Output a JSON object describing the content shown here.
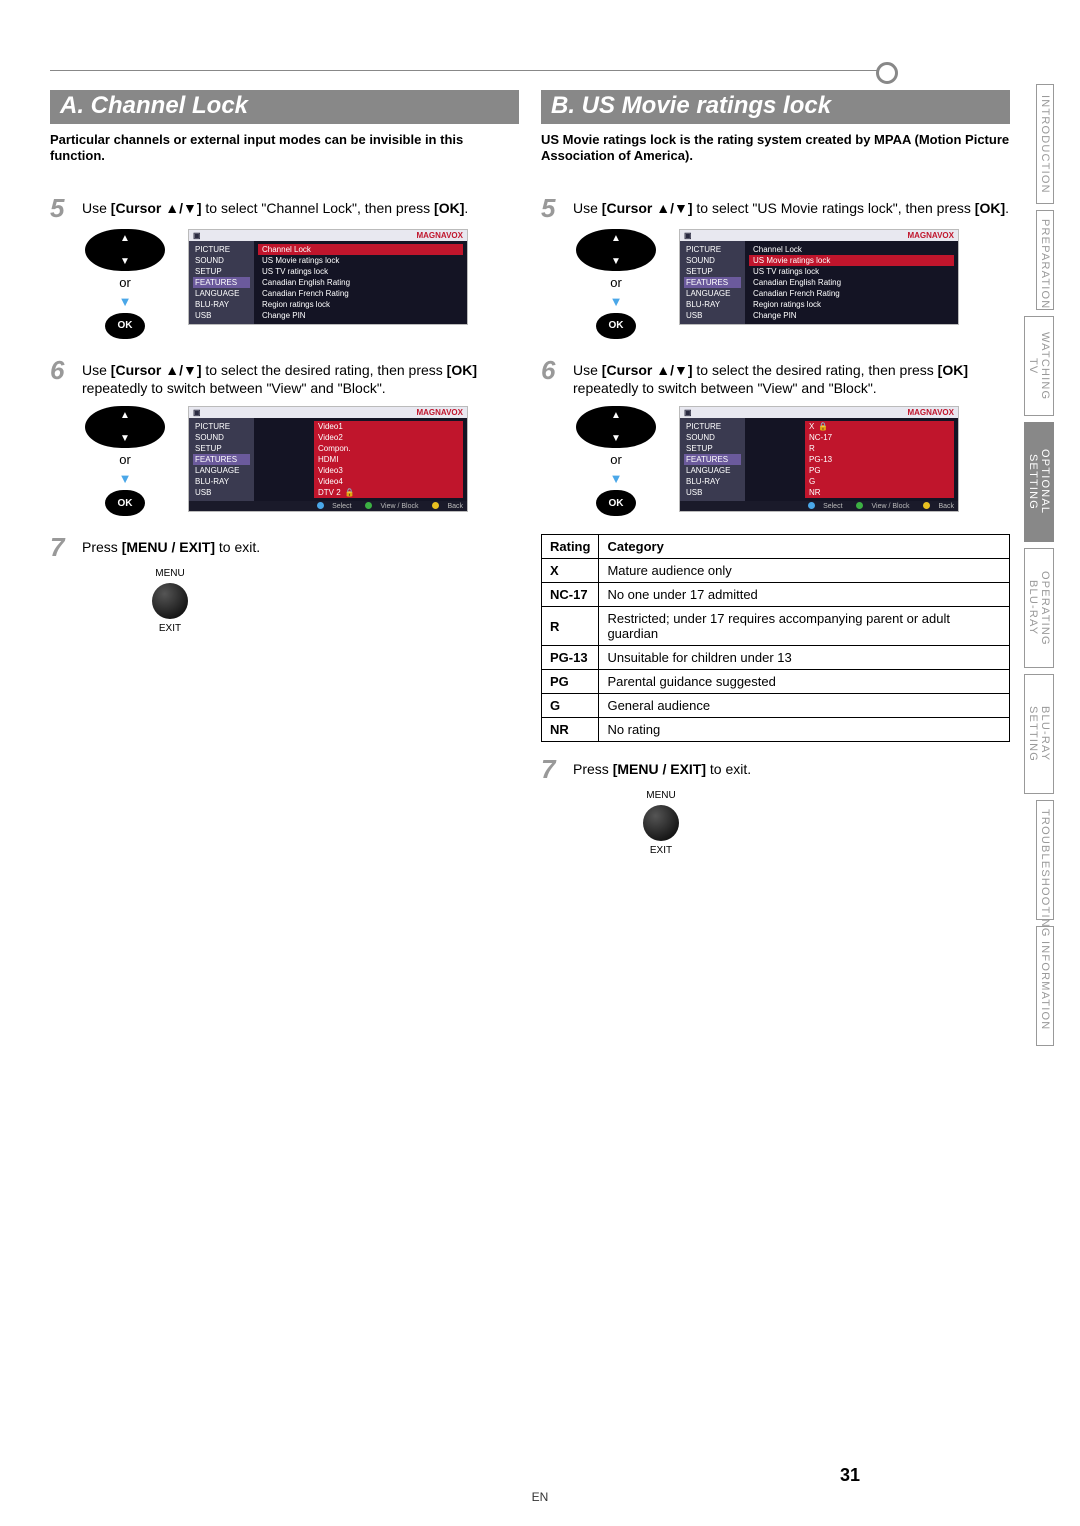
{
  "page_number": "31",
  "page_lang": "EN",
  "side_tabs": {
    "introduction": "INTRODUCTION",
    "preparation": "PREPARATION",
    "watching_tv": "WATCHING TV",
    "optional_setting": "OPTIONAL SETTING",
    "operating_bluray": "OPERATING BLU-RAY",
    "bluray_setting": "BLU-RAY SETTING",
    "troubleshooting": "TROUBLESHOOTING",
    "information": "INFORMATION"
  },
  "common": {
    "or": "or",
    "ok": "OK",
    "menu": "MENU",
    "exit": "EXIT",
    "brand": "MAGNAVOX",
    "osd_side": [
      "PICTURE",
      "SOUND",
      "SETUP",
      "FEATURES",
      "LANGUAGE",
      "BLU-RAY",
      "USB"
    ],
    "osd_feature_rows": [
      "Channel Lock",
      "US Movie ratings lock",
      "US TV ratings lock",
      "Canadian English Rating",
      "Canadian French Rating",
      "Region ratings lock",
      "Change PIN"
    ],
    "osd_foot_select": "Select",
    "osd_foot_view": "View / Block",
    "osd_foot_back": "Back"
  },
  "colA": {
    "title": "A.  Channel Lock",
    "intro": "Particular channels or external input modes can be invisible in this function.",
    "step5_a": "Use ",
    "step5_b": "[Cursor ▲/▼]",
    "step5_c": " to select \"Channel Lock\", then press ",
    "step5_d": "[OK]",
    "step5_e": ".",
    "step6_a": "Use ",
    "step6_b": "[Cursor ▲/▼]",
    "step6_c": " to select the desired rating, then press ",
    "step6_d": "[OK]",
    "step6_e": " repeatedly to switch between \"View\" and \"Block\".",
    "step7": "Press ",
    "step7_b": "[MENU / EXIT]",
    "step7_c": " to exit.",
    "osd2_rows": [
      "Video1",
      "Video2",
      "Compon.",
      "HDMI",
      "Video3",
      "Video4",
      "DTV 2"
    ]
  },
  "colB": {
    "title": "B. US Movie ratings lock",
    "intro": "US Movie ratings lock is the rating system created by MPAA (Motion Picture Association of America).",
    "step5_a": "Use ",
    "step5_b": "[Cursor ▲/▼]",
    "step5_c": " to select \"US Movie ratings lock\", then press ",
    "step5_d": "[OK]",
    "step5_e": ".",
    "step6_a": "Use ",
    "step6_b": "[Cursor ▲/▼]",
    "step6_c": " to select the desired rating, then press ",
    "step6_d": "[OK]",
    "step6_e": " repeatedly to switch between \"View\" and \"Block\".",
    "step7": "Press ",
    "step7_b": "[MENU / EXIT]",
    "step7_c": " to exit.",
    "osd2_rows": [
      "X",
      "NC-17",
      "R",
      "PG-13",
      "PG",
      "G",
      "NR"
    ],
    "table_head_rating": "Rating",
    "table_head_cat": "Category",
    "table": [
      {
        "r": "X",
        "c": "Mature audience only"
      },
      {
        "r": "NC-17",
        "c": "No one under 17 admitted"
      },
      {
        "r": "R",
        "c": "Restricted; under 17 requires accompanying parent or adult guardian"
      },
      {
        "r": "PG-13",
        "c": "Unsuitable for children under 13"
      },
      {
        "r": "PG",
        "c": "Parental guidance suggested"
      },
      {
        "r": "G",
        "c": "General audience"
      },
      {
        "r": "NR",
        "c": "No rating"
      }
    ]
  }
}
